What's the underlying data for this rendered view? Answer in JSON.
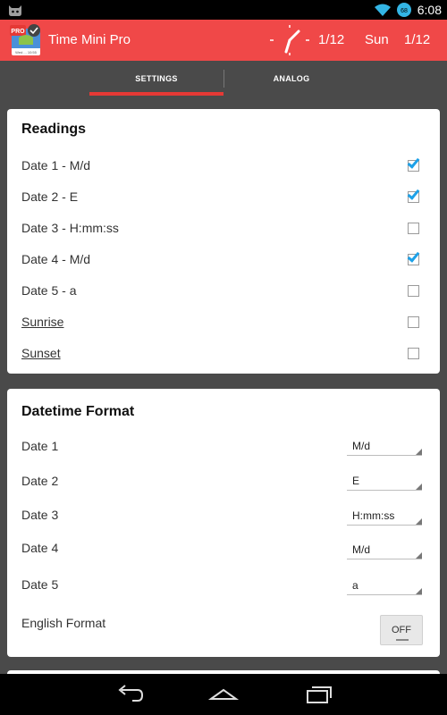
{
  "status_bar": {
    "time": "6:08"
  },
  "app_bar": {
    "title": "Time Mini Pro",
    "icon_badge": "PRO",
    "icon_subtext": "Wed ... 10:55",
    "date": "1/12",
    "day": "Sun",
    "date2": "1/12"
  },
  "tabs": [
    {
      "label": "SETTINGS",
      "selected": true
    },
    {
      "label": "ANALOG",
      "selected": false
    }
  ],
  "readings": {
    "title": "Readings",
    "items": [
      {
        "label": "Date 1 - M/d",
        "checked": true
      },
      {
        "label": "Date 2 - E",
        "checked": true
      },
      {
        "label": "Date 3 - H:mm:ss",
        "checked": false
      },
      {
        "label": "Date 4 - M/d",
        "checked": true
      },
      {
        "label": "Date 5 - a",
        "checked": false
      },
      {
        "label": "Sunrise",
        "checked": false
      },
      {
        "label": "Sunset",
        "checked": false
      }
    ]
  },
  "datetime_format": {
    "title": "Datetime Format",
    "rows": [
      {
        "label": "Date 1",
        "value": "M/d"
      },
      {
        "label": "Date 2",
        "value": "E"
      },
      {
        "label": "Date 3",
        "value": "H:mm:ss"
      },
      {
        "label": "Date 4",
        "value": "M/d"
      },
      {
        "label": "Date 5",
        "value": "a"
      }
    ],
    "english_format": {
      "label": "English Format",
      "value": "OFF"
    }
  },
  "colors": {
    "app_bar": "#f04848",
    "accent_tab": "#e53935",
    "checkbox_tick": "#1da1e8",
    "background": "#4a4a4a"
  }
}
